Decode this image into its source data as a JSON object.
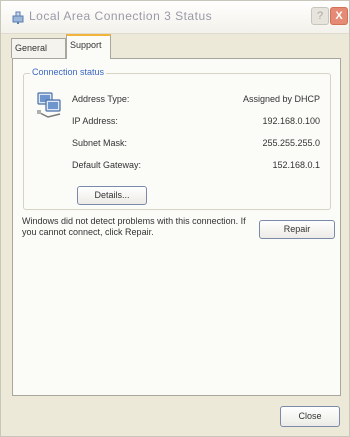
{
  "window": {
    "title": "Local Area Connection 3 Status",
    "help_label": "?",
    "close_label": "X"
  },
  "tabs": [
    {
      "label": "General"
    },
    {
      "label": "Support",
      "selected": true
    }
  ],
  "connection_status": {
    "group_label": "Connection status",
    "icon": "network-connection-icon",
    "rows": [
      {
        "label": "Address Type:",
        "value": "Assigned by DHCP"
      },
      {
        "label": "IP Address:",
        "value": "192.168.0.100"
      },
      {
        "label": "Subnet Mask:",
        "value": "255.255.255.0"
      },
      {
        "label": "Default Gateway:",
        "value": "152.168.0.1"
      }
    ],
    "details_label": "Details..."
  },
  "repair_section": {
    "message": "Windows did not detect problems with this connection. If you cannot connect, click Repair.",
    "repair_label": "Repair"
  },
  "footer": {
    "close_label": "Close"
  },
  "colors": {
    "window_bg": "#ece9d8",
    "panel_bg": "#fbfbf8",
    "group_label": "#3c66c4",
    "selected_tab_accent": "#f2b43a",
    "close_button": "#e58a74"
  }
}
